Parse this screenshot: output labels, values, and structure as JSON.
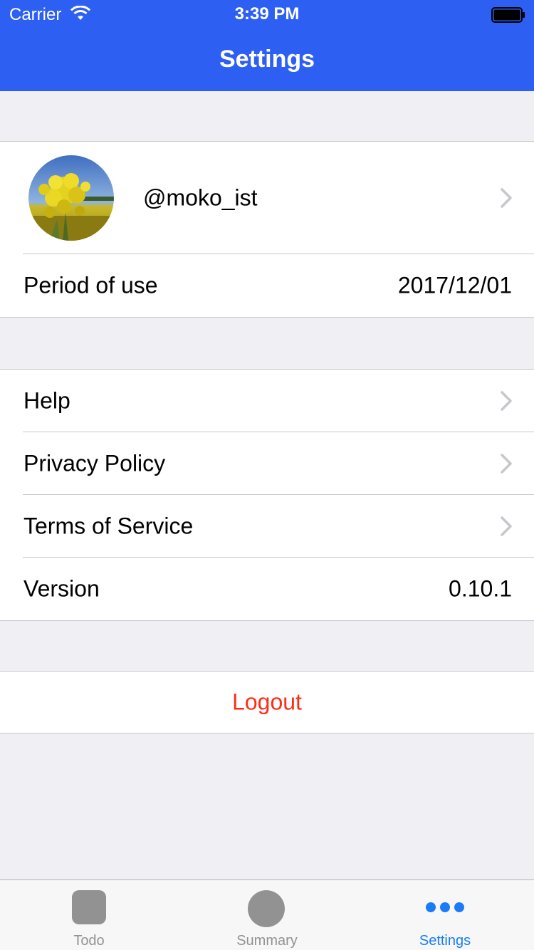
{
  "status_bar": {
    "carrier": "Carrier",
    "time": "3:39 PM"
  },
  "nav": {
    "title": "Settings",
    "background_color": "#2d5ff2"
  },
  "profile": {
    "username": "@moko_ist",
    "avatar": "photo of yellow rapeseed flowers under a blue sky"
  },
  "account_info": {
    "period_label": "Period of use",
    "period_value": "2017/12/01"
  },
  "links": [
    {
      "label": "Help"
    },
    {
      "label": "Privacy Policy"
    },
    {
      "label": "Terms of Service"
    }
  ],
  "version": {
    "label": "Version",
    "value": "0.10.1"
  },
  "logout": {
    "label": "Logout",
    "color": "#ff2d16"
  },
  "tabbar": {
    "tabs": [
      {
        "label": "Todo",
        "icon": "square-icon",
        "active": false
      },
      {
        "label": "Summary",
        "icon": "circle-icon",
        "active": false
      },
      {
        "label": "Settings",
        "icon": "more-dots-icon",
        "active": true
      }
    ],
    "active_color": "#1a7cf7",
    "inactive_color": "#929292"
  }
}
